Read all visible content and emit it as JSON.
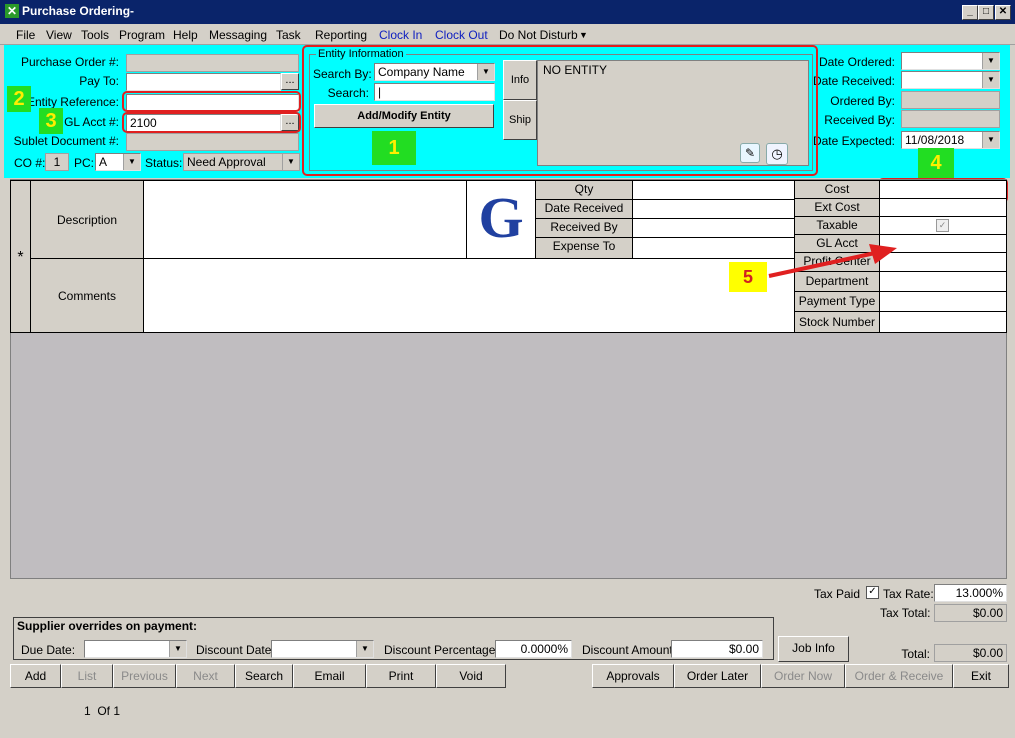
{
  "window": {
    "title": "Purchase Ordering-"
  },
  "menu": [
    "File",
    "View",
    "Tools",
    "Program",
    "Help",
    "Messaging",
    "Task",
    "Reporting",
    "Clock In",
    "Clock Out",
    "Do Not Disturb"
  ],
  "left": {
    "po_label": "Purchase Order #:",
    "payto_label": "Pay To:",
    "entity_ref_label": "Entity Reference:",
    "glacct_label": "GL Acct #:",
    "glacct_value": "2100",
    "sublet_label": "Sublet Document #:",
    "co_label": "CO #:",
    "co_value": "1",
    "pc_label": "PC:",
    "pc_value": "A",
    "status_label": "Status:",
    "status_value": "Need Approval"
  },
  "entity": {
    "group_title": "Entity Information",
    "search_by_label": "Search By:",
    "search_by_value": "Company Name",
    "search_label": "Search:",
    "search_value": "|",
    "add_modify_button": "Add/Modify Entity",
    "tab_info": "Info",
    "tab_ship": "Ship",
    "no_entity": "NO ENTITY"
  },
  "right": {
    "date_ordered_label": "Date Ordered:",
    "date_received_label": "Date Received:",
    "ordered_by_label": "Ordered By:",
    "received_by_label": "Received By:",
    "date_expected_label": "Date Expected:",
    "date_expected_value": "11/08/2018"
  },
  "annotations": [
    "1",
    "2",
    "3",
    "4",
    "5"
  ],
  "grid": {
    "marker": "*",
    "description_label": "Description",
    "comments_label": "Comments",
    "logo_letter": "G",
    "mid_labels": [
      "Qty",
      "Date Received",
      "Received By",
      "Expense To"
    ],
    "right_labels": [
      "Cost",
      "Ext Cost",
      "Taxable",
      "GL Acct",
      "Profit Center",
      "Department",
      "Payment Type",
      "Stock Number"
    ]
  },
  "totals": {
    "tax_paid_label": "Tax Paid",
    "tax_rate_label": "Tax Rate:",
    "tax_rate_value": "13.000%",
    "tax_total_label": "Tax Total:",
    "tax_total_value": "$0.00",
    "total_label": "Total:",
    "total_value": "$0.00"
  },
  "supplier": {
    "title": "Supplier overrides on payment:",
    "due_date_label": "Due Date:",
    "discount_date_label": "Discount Date:",
    "discount_pct_label": "Discount Percentage:",
    "discount_pct_value": "0.0000%",
    "discount_amt_label": "Discount Amount:",
    "discount_amt_value": "$0.00",
    "job_info_button": "Job Info"
  },
  "buttons": {
    "add": "Add",
    "list": "List",
    "previous": "Previous",
    "next": "Next",
    "search": "Search",
    "email": "Email",
    "print": "Print",
    "void": "Void",
    "approvals": "Approvals",
    "order_later": "Order Later",
    "order_now": "Order Now",
    "order_receive": "Order & Receive",
    "exit": "Exit"
  },
  "pager": "1  Of 1",
  "colors": {
    "header_bg": "#00ffff",
    "annotation_red": "#e02020",
    "annotation_green": "#22dd22",
    "annotation_yellow": "#ffff00"
  }
}
